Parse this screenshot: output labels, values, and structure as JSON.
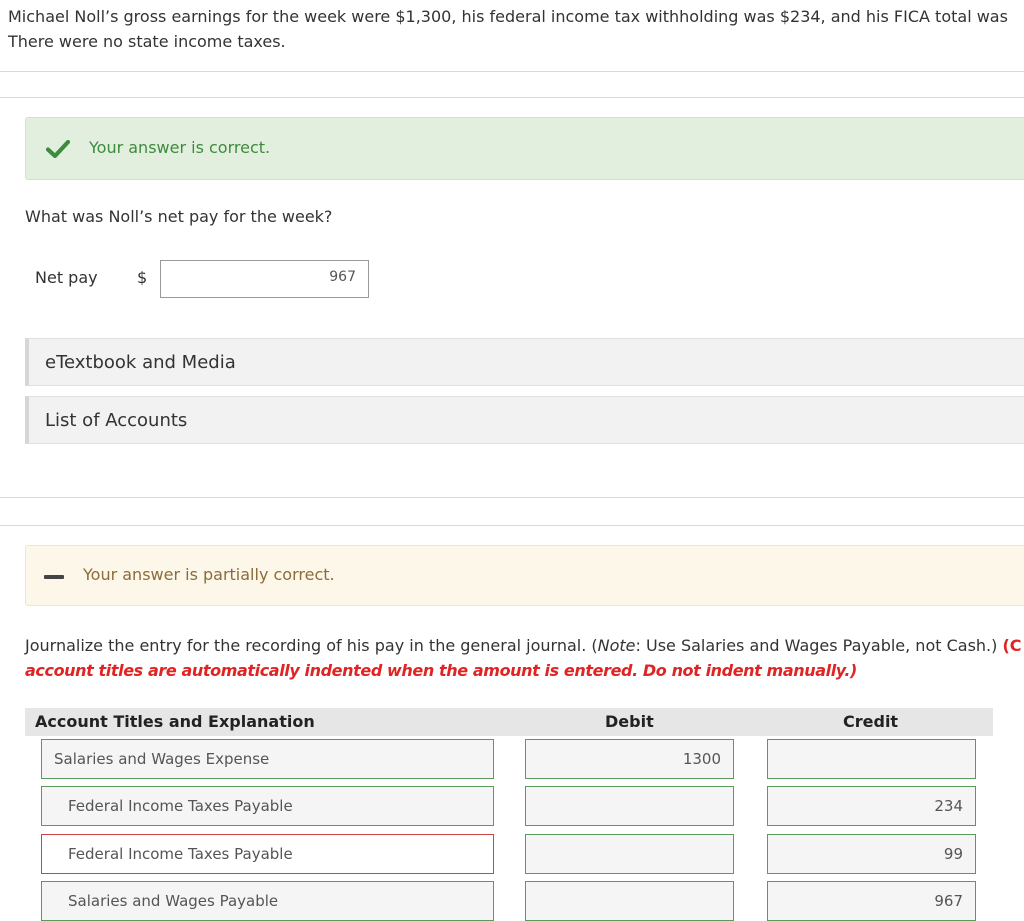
{
  "problem": {
    "line1": "Michael Noll’s gross earnings for the week were $1,300, his federal income tax withholding was $234, and his FICA total was",
    "line2": "There were no state income taxes."
  },
  "part_a": {
    "feedback": "Your answer is correct.",
    "question": "What was Noll’s net pay for the week?",
    "net_pay_label": "Net pay",
    "currency": "$",
    "net_pay_value": "967",
    "etextbook_label": "eTextbook and Media",
    "list_of_accounts_label": "List of Accounts"
  },
  "part_b": {
    "feedback": "Your answer is partially correct.",
    "instruction_main": "Journalize the entry for the recording of his pay in the general journal. (",
    "instruction_note_label": "Note",
    "instruction_note_rest": ": Use Salaries and Wages Payable, not Cash.) ",
    "instruction_red_open": "(C",
    "instruction_red_line2": "account titles are automatically indented when the amount is entered. Do not indent manually.)",
    "table": {
      "headers": {
        "account": "Account Titles and Explanation",
        "debit": "Debit",
        "credit": "Credit"
      },
      "rows": [
        {
          "account": "Salaries and Wages Expense",
          "debit": "1300",
          "credit": "",
          "status": "correct"
        },
        {
          "account": "Federal Income Taxes Payable",
          "debit": "",
          "credit": "234",
          "status": "correct"
        },
        {
          "account": "Federal Income Taxes Payable",
          "debit": "",
          "credit": "99",
          "status": "incorrect"
        },
        {
          "account": "Salaries and Wages Payable",
          "debit": "",
          "credit": "967",
          "status": "correct"
        }
      ]
    }
  },
  "colors": {
    "correct_green": "#3d8b3d",
    "error_red": "#e02424",
    "partial_text": "#8a6d3b"
  },
  "icons": {
    "correct": "check-icon",
    "partial": "dash-icon"
  }
}
